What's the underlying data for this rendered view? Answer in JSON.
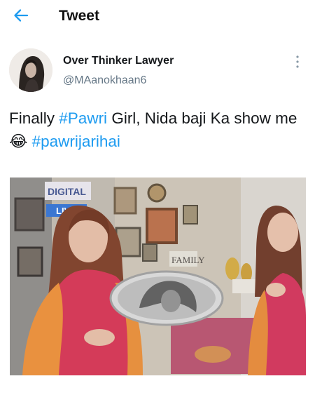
{
  "header": {
    "title": "Tweet",
    "back_icon": "arrow-left-icon",
    "accent": "#1d9bf0"
  },
  "author": {
    "display_name": "Over Thinker Lawyer",
    "handle": "@MAanokhaan6",
    "more_icon": "more-vertical-icon"
  },
  "tweet": {
    "text_before": "Finally ",
    "hashtag_1": "#Pawri",
    "text_middle": " Girl,  Nida baji Ka show me ",
    "emoji": "😂",
    "hashtag_2": "#pawrijarihai"
  },
  "media": {
    "channel_logo": "DIGITAL",
    "live_badge": "LIVE",
    "sign_text": "FAMILY"
  }
}
